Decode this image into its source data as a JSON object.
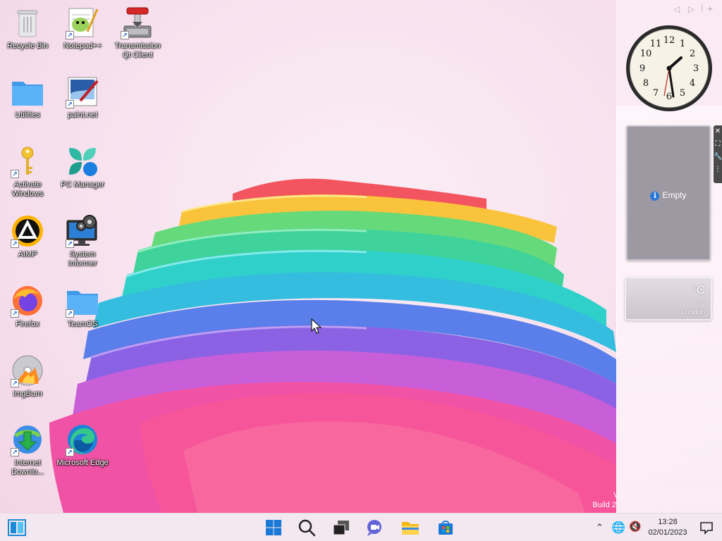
{
  "desktop": {
    "icons": [
      {
        "label": "Recycle Bin",
        "icon": "recycle-bin-icon"
      },
      {
        "label": "Notepad++",
        "icon": "notepad-plus-plus-icon"
      },
      {
        "label": "Transmission Qt Client",
        "icon": "transmission-icon"
      },
      {
        "label": "Utilities",
        "icon": "folder-icon"
      },
      {
        "label": "paint.net",
        "icon": "paint-net-icon"
      },
      {
        "label": "Activate Windows",
        "icon": "key-icon"
      },
      {
        "label": "PC Manager",
        "icon": "pc-manager-icon"
      },
      {
        "label": "AIMP",
        "icon": "aimp-icon"
      },
      {
        "label": "System Informer",
        "icon": "system-informer-icon"
      },
      {
        "label": "Firefox",
        "icon": "firefox-icon"
      },
      {
        "label": "TeamOS",
        "icon": "folder-icon"
      },
      {
        "label": "ImgBurn",
        "icon": "imgburn-icon"
      },
      {
        "label": "Internet Downlo...",
        "icon": "internet-download-manager-icon"
      },
      {
        "label": "Microsoft Edge",
        "icon": "edge-icon"
      }
    ]
  },
  "sidebar": {
    "slideshow_text": "Empty",
    "weather": {
      "unit": "°C",
      "temps": "° /°",
      "city": "London"
    }
  },
  "watermark": {
    "line1": "V",
    "line2": "Build 2"
  },
  "taskbar": {
    "time": "13:28",
    "date": "02/01/2023"
  },
  "colors": {
    "accent": "#1a78d6",
    "taskbar_bg": "#f3e8ef"
  }
}
